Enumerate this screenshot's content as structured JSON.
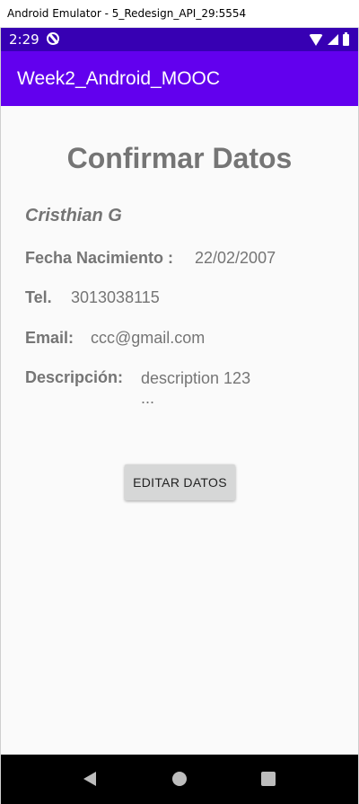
{
  "window": {
    "title": "Android Emulator - 5_Redesign_API_29:5554"
  },
  "status_bar": {
    "time": "2:29",
    "icons": [
      "sync-off-icon",
      "wifi-icon",
      "signal-icon",
      "battery-icon"
    ],
    "color": "#3700b3"
  },
  "app_bar": {
    "title": "Week2_Android_MOOC",
    "color": "#6200ee"
  },
  "confirm": {
    "title": "Confirmar Datos",
    "name": "Cristhian G",
    "fields": [
      {
        "label": "Fecha Nacimiento :",
        "value": "22/02/2007"
      },
      {
        "label": "Tel.",
        "value": "3013038115"
      },
      {
        "label": "Email:",
        "value": "ccc@gmail.com"
      },
      {
        "label": "Descripción:",
        "value": "description 123\n..."
      }
    ],
    "edit_button": "EDITAR DATOS"
  },
  "nav_bar": {
    "icons": [
      "back-icon",
      "home-icon",
      "recents-icon"
    ]
  }
}
